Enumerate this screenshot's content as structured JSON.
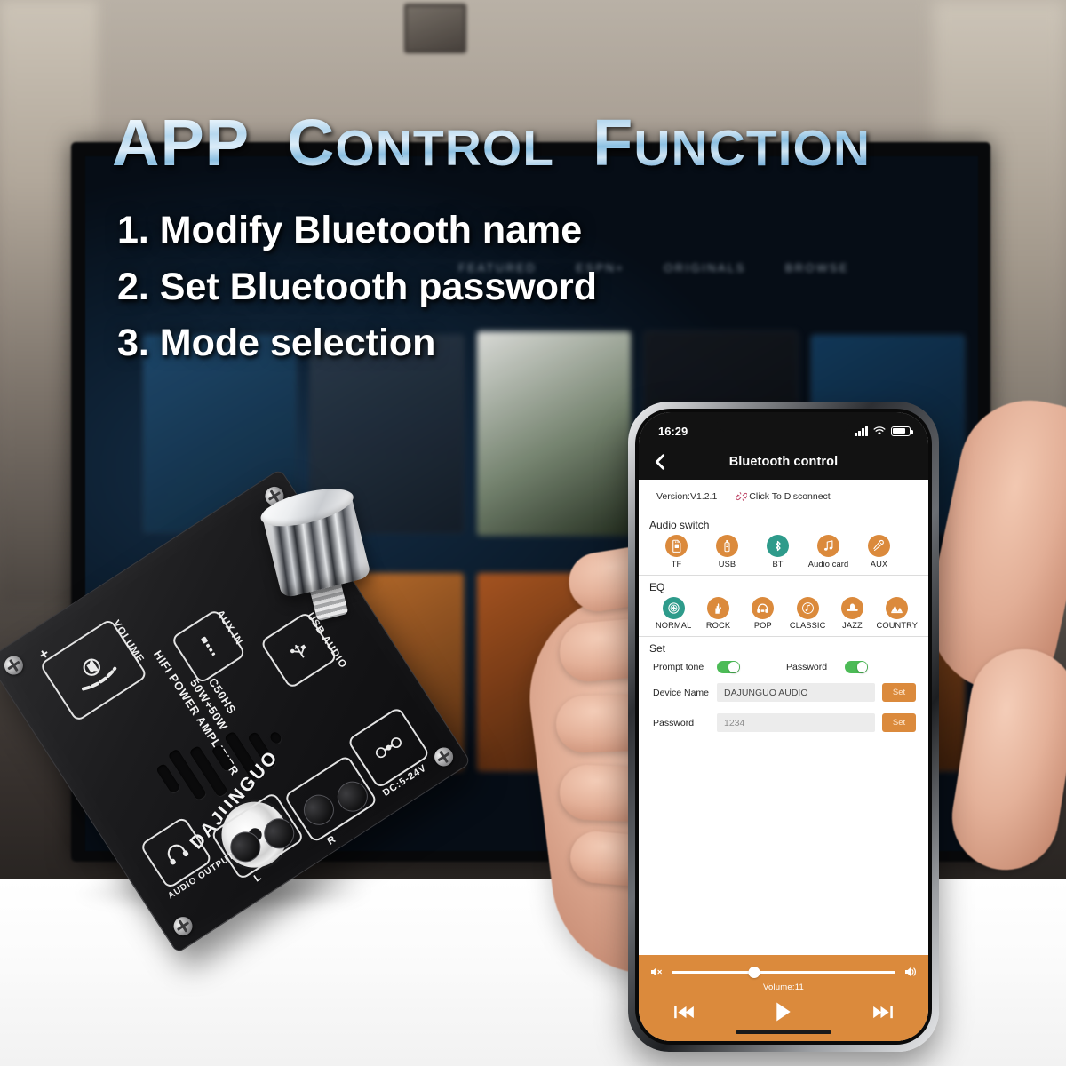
{
  "promo": {
    "headline_parts": [
      "APP",
      "C",
      "ONTROL",
      "F",
      "UNCTION"
    ],
    "headline_full": "APP CONTROL FUNCTION",
    "bullets": [
      "1. Modify Bluetooth name",
      "2. Set Bluetooth password",
      "3. Mode selection"
    ],
    "tv_nav": [
      "FEATURED",
      "ESPN+",
      "ORIGINALS",
      "BROWSE"
    ]
  },
  "board": {
    "model_line1": "C50HS",
    "model_line2": "50W+50W",
    "model_line3": "HIFI POWER AMPLIFIER",
    "brand": "DAJUNGUO",
    "labels": {
      "volume": "VOLUME",
      "aux_in": "AUX IN",
      "usb_audio": "USB AUDIO",
      "audio_output": "AUDIO OUTPUT",
      "left": "L",
      "right": "R",
      "plus": "+",
      "minus": "-",
      "dc": "DC:5-24V"
    }
  },
  "phone": {
    "status": {
      "time": "16:29",
      "signal_icon": "signal-bars-icon",
      "wifi_icon": "wifi-icon",
      "battery_icon": "battery-icon"
    },
    "nav": {
      "back_icon": "chevron-left-icon",
      "title": "Bluetooth control"
    },
    "info": {
      "version": "Version:V1.2.1",
      "disconnect_label": "Click To Disconnect",
      "disconnect_icon": "broken-link-icon"
    },
    "audio_switch": {
      "title": "Audio switch",
      "items": [
        {
          "label": "TF",
          "icon": "sd-card-icon",
          "active": false
        },
        {
          "label": "USB",
          "icon": "usb-drive-icon",
          "active": false
        },
        {
          "label": "BT",
          "icon": "bluetooth-icon",
          "active": true
        },
        {
          "label": "Audio card",
          "icon": "music-note-icon",
          "active": false
        },
        {
          "label": "AUX",
          "icon": "aux-cable-icon",
          "active": false
        }
      ]
    },
    "eq": {
      "title": "EQ",
      "items": [
        {
          "label": "NORMAL",
          "icon": "target-icon",
          "active": true
        },
        {
          "label": "ROCK",
          "icon": "rock-hand-icon",
          "active": false
        },
        {
          "label": "POP",
          "icon": "headphones-icon",
          "active": false
        },
        {
          "label": "CLASSIC",
          "icon": "vinyl-note-icon",
          "active": false
        },
        {
          "label": "JAZZ",
          "icon": "hat-icon",
          "active": false
        },
        {
          "label": "COUNTRY",
          "icon": "mountain-icon",
          "active": false
        }
      ]
    },
    "set": {
      "title": "Set",
      "prompt_tone_label": "Prompt tone",
      "prompt_tone_on": true,
      "password_toggle_label": "Password",
      "password_toggle_on": true,
      "device_name_label": "Device Name",
      "device_name_value": "DAJUNGUO AUDIO",
      "device_name_set_button": "Set",
      "password_label": "Password",
      "password_placeholder": "1234",
      "password_set_button": "Set"
    },
    "player": {
      "mute_icon": "volume-mute-icon",
      "volume_icon": "volume-up-icon",
      "volume_text": "Volume:11",
      "volume_percent": 37,
      "prev_icon": "previous-track-icon",
      "play_icon": "play-icon",
      "next_icon": "next-track-icon"
    }
  },
  "colors": {
    "accent_orange": "#DB8A3C",
    "active_teal": "#2E9B8B",
    "toggle_green": "#4CBB56",
    "navbar_black": "#121212",
    "field_gray": "#ECECEC"
  }
}
